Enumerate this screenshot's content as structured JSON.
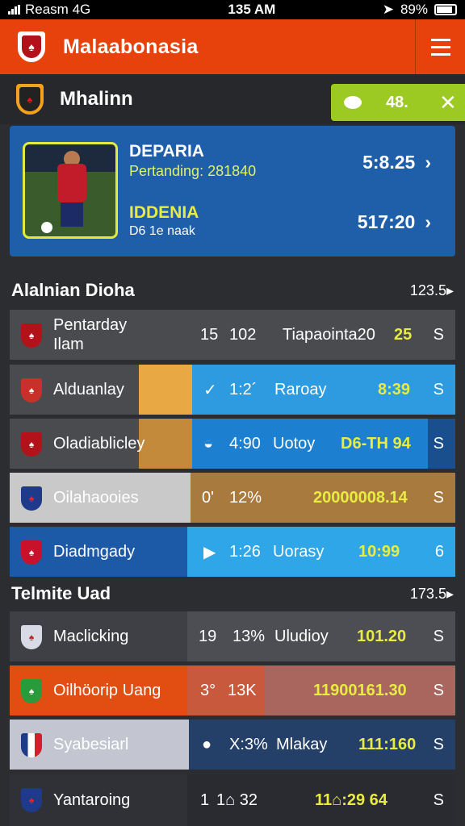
{
  "status": {
    "carrier": "Reasm 4G",
    "time": "135 AM",
    "battery": "89%"
  },
  "header": {
    "app_title": "Malaabonasia"
  },
  "subheader": {
    "title": "Mhalinn",
    "badge_text": "48."
  },
  "featured": {
    "title": "DEPARIA",
    "subtitle": "Pertanding: 281840",
    "odd1": "5:8.25",
    "team": "IDDENIA",
    "team_sub": "D6 1e naak",
    "odd2": "517:20"
  },
  "section1": {
    "title": "Alalnian Dioha",
    "right": "123.5▸"
  },
  "section2": {
    "title": "Telmite Uad",
    "right": "173.5▸"
  },
  "rows1": [
    {
      "name": "Pentarday Ilam",
      "c1": "15",
      "c2": "102",
      "c3": "Tiapaointa20",
      "c4": "25",
      "end": "S"
    },
    {
      "name": "Alduanlay",
      "c1": "✓",
      "c2": "1:2´",
      "c3": "Raroay",
      "c4": "8:39",
      "end": "S"
    },
    {
      "name": "Oladiablicley",
      "c1": "◒",
      "c2": "4:90",
      "c3": "Uotoy",
      "c4": "D6-TH 94",
      "end": "S"
    },
    {
      "name": "Oilahaooies",
      "c1": "0'",
      "c2": "12%",
      "c3": "",
      "c4": "20000008.14",
      "end": "S"
    },
    {
      "name": "Diadmgady",
      "c1": "▶",
      "c2": "1:26",
      "c3": "Uorasy",
      "c4": "10:99",
      "end": "6"
    }
  ],
  "rows2": [
    {
      "name": "Maclicking",
      "c1": "19",
      "c2": "13%",
      "c3": "Uludioy",
      "c4": "101.20",
      "end": "S"
    },
    {
      "name": "Oilhöorip Uang",
      "c1": "3°",
      "c2": "13K",
      "c3": "",
      "c4": "11900161.30",
      "end": "S"
    },
    {
      "name": "Syabesiarl",
      "c1": "●",
      "c2": "X:3%",
      "c3": "Mlakay",
      "c4": "111:160",
      "end": "S"
    },
    {
      "name": "Yantaroing",
      "c1": "1",
      "c2": "1⌂ 32",
      "c3": "",
      "c4": "11⌂:29 64",
      "end": "S"
    }
  ],
  "colors": {
    "accent": "#e8420c",
    "blue": "#1f5ea8",
    "lime": "#9cc922",
    "yellow": "#e8ec42"
  }
}
